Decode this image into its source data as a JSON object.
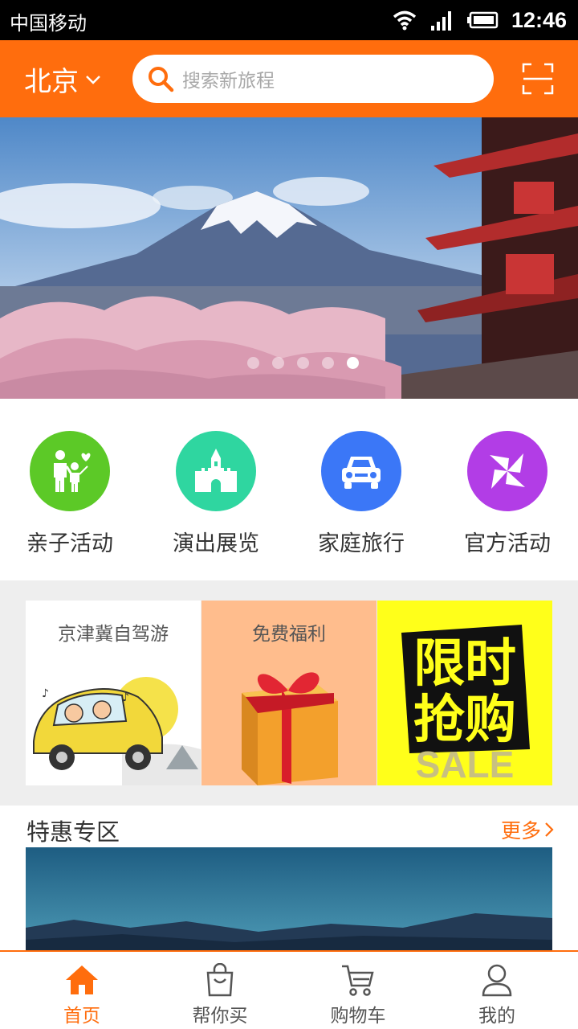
{
  "status_bar": {
    "carrier": "中国移动",
    "time": "12:46"
  },
  "header": {
    "city": "北京",
    "search_placeholder": "搜索新旅程"
  },
  "banner": {
    "slide_count": 5,
    "active_slide": 5
  },
  "categories": [
    {
      "label": "亲子活动",
      "color": "#5cc927",
      "icon": "family-icon"
    },
    {
      "label": "演出展览",
      "color": "#2fd6a0",
      "icon": "castle-icon"
    },
    {
      "label": "家庭旅行",
      "color": "#3b77f7",
      "icon": "car-icon"
    },
    {
      "label": "官方活动",
      "color": "#b23de6",
      "icon": "pinwheel-icon"
    }
  ],
  "promo": {
    "card1_title": "京津冀自驾游",
    "card2_title": "免费福利",
    "card3_text_line1": "限时",
    "card3_text_line2": "抢购",
    "card3_sale": "SALE"
  },
  "deals": {
    "title": "特惠专区",
    "more": "更多"
  },
  "tabs": [
    {
      "label": "首页",
      "icon": "home-icon",
      "active": true
    },
    {
      "label": "帮你买",
      "icon": "shopping-bag-icon",
      "active": false
    },
    {
      "label": "购物车",
      "icon": "cart-icon",
      "active": false
    },
    {
      "label": "我的",
      "icon": "user-icon",
      "active": false
    }
  ],
  "colors": {
    "brand": "#ff6d0d"
  }
}
